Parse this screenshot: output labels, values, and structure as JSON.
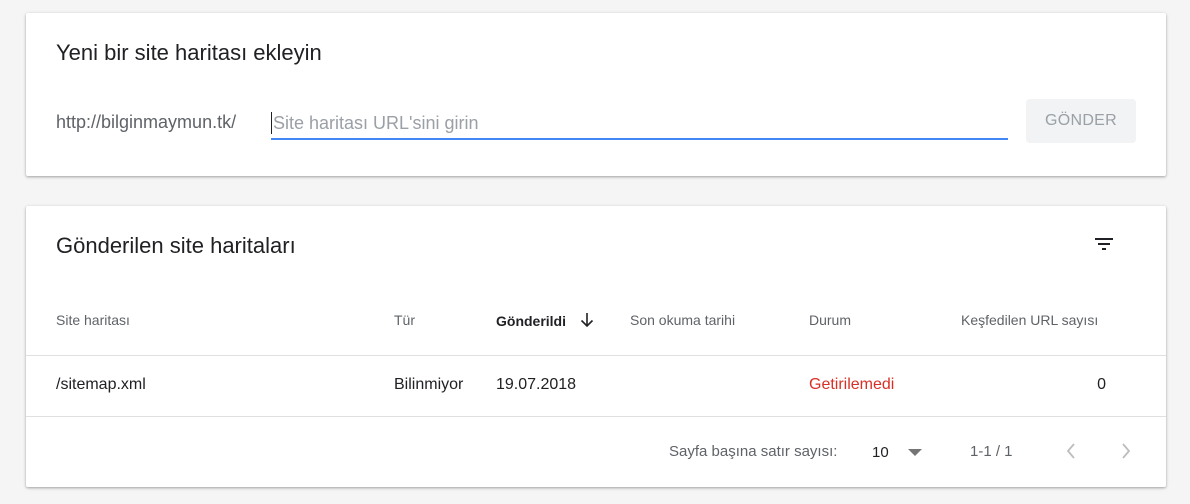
{
  "add_sitemap": {
    "title": "Yeni bir site haritası ekleyin",
    "url_prefix": "http://bilginmaymun.tk/",
    "input_placeholder": "Site haritası URL'sini girin",
    "input_value": "",
    "submit_label": "GÖNDER"
  },
  "submitted": {
    "title": "Gönderilen site haritaları",
    "filter_icon": "filter-list-icon",
    "columns": {
      "sitemap": "Site haritası",
      "type": "Tür",
      "submitted": "Gönderildi",
      "last_read": "Son okuma tarihi",
      "status": "Durum",
      "discovered": "Keşfedilen URL sayısı"
    },
    "sort_icon": "arrow-down-icon",
    "rows": [
      {
        "sitemap": "/sitemap.xml",
        "type": "Bilinmiyor",
        "submitted": "19.07.2018",
        "last_read": "",
        "status": "Getirilemedi",
        "discovered": "0"
      }
    ],
    "pagination": {
      "rows_per_page_label": "Sayfa başına satır sayısı:",
      "rows_per_page_value": "10",
      "range": "1-1 / 1"
    }
  },
  "colors": {
    "accent": "#4285f4",
    "error": "#d93025",
    "background": "#f5f5f5"
  }
}
